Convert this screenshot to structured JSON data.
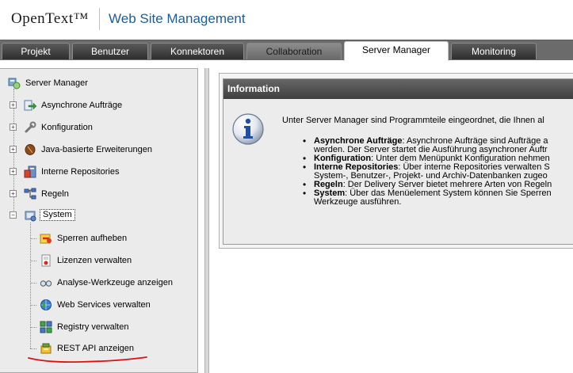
{
  "header": {
    "logo": "OpenText™",
    "product": "Web Site Management"
  },
  "tabs": [
    {
      "label": "Projekt"
    },
    {
      "label": "Benutzer"
    },
    {
      "label": "Konnektoren"
    },
    {
      "label": "Collaboration"
    },
    {
      "label": "Server Manager"
    },
    {
      "label": "Monitoring"
    }
  ],
  "active_tab": "Server Manager",
  "tree": {
    "root": "Server Manager",
    "items": [
      {
        "label": "Asynchrone Aufträge",
        "icon": "async-jobs-icon"
      },
      {
        "label": "Konfiguration",
        "icon": "wrench-icon"
      },
      {
        "label": "Java-basierte Erweiterungen",
        "icon": "java-bean-icon"
      },
      {
        "label": "Interne Repositories",
        "icon": "repository-icon"
      },
      {
        "label": "Regeln",
        "icon": "rules-icon"
      },
      {
        "label": "System",
        "icon": "system-icon"
      }
    ],
    "system_children": [
      {
        "label": "Sperren aufheben",
        "icon": "unlock-icon"
      },
      {
        "label": "Lizenzen verwalten",
        "icon": "license-icon"
      },
      {
        "label": "Analyse-Werkzeuge anzeigen",
        "icon": "analysis-glasses-icon"
      },
      {
        "label": "Web Services verwalten",
        "icon": "web-services-globe-icon"
      },
      {
        "label": "Registry verwalten",
        "icon": "registry-icon"
      },
      {
        "label": "REST API anzeigen",
        "icon": "rest-api-icon"
      }
    ]
  },
  "info": {
    "title": "Information",
    "intro": "Unter Server Manager sind Programmteile eingeordnet, die Ihnen al",
    "items": [
      {
        "bold": "Asynchrone Aufträge",
        "text": ": Asynchrone Aufträge sind Aufträge a",
        "cont": "werden. Der Server startet die Ausführung asynchroner Auftr"
      },
      {
        "bold": "Konfiguration",
        "text": ": Unter dem Menüpunkt Konfiguration nehmen",
        "cont": ""
      },
      {
        "bold": "Interne Repositories",
        "text": ": Über interne Repositories verwalten S",
        "cont": "System-, Benutzer-, Projekt- und Archiv-Datenbanken zugeo"
      },
      {
        "bold": "Regeln",
        "text": ": Der Delivery Server bietet mehrere Arten von Regeln",
        "cont": ""
      },
      {
        "bold": "System",
        "text": ": Über das Menüelement System können Sie Sperren",
        "cont": "Werkzeuge ausführen."
      }
    ]
  },
  "colors": {
    "tab_bar": "#6b6b6b",
    "product_name": "#1f5c99",
    "info_header": "#4a4a4a",
    "annotation_red": "#e01010"
  }
}
